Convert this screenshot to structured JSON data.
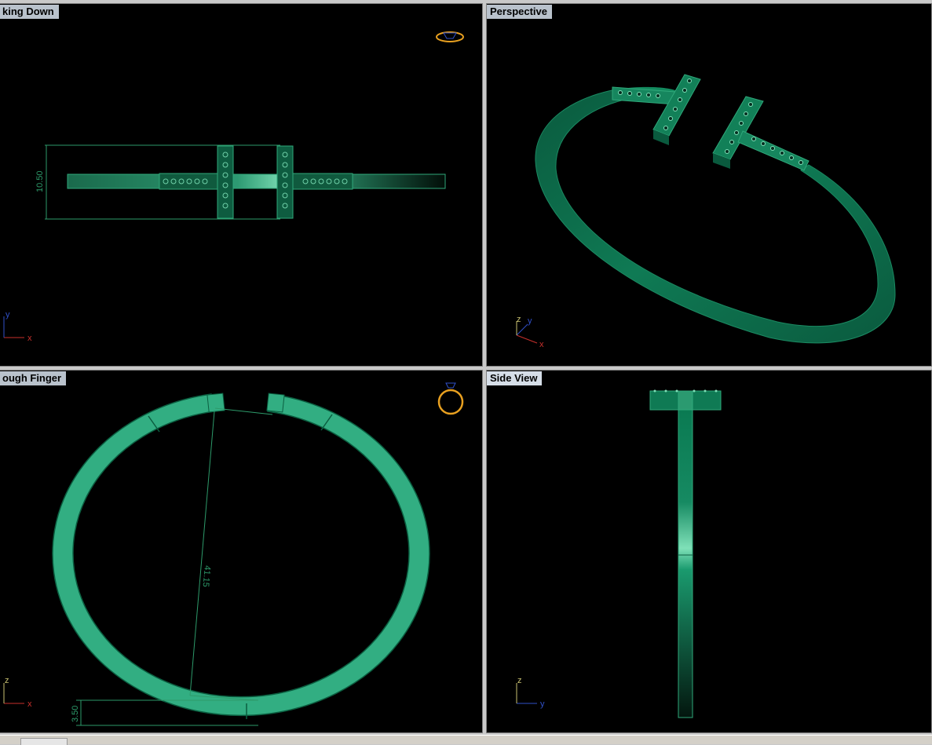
{
  "viewports": {
    "top": {
      "title": "king Down",
      "x_axis": "x",
      "y_axis": "y",
      "dimension": "10.50"
    },
    "perspective": {
      "title": "Perspective",
      "x_axis": "x",
      "y_axis": "y",
      "z_axis": "z"
    },
    "front": {
      "title": "ough Finger",
      "x_axis": "x",
      "z_axis": "z",
      "dimension_diameter": "41.15",
      "dimension_thickness": "3.50"
    },
    "side": {
      "title": "Side View",
      "y_axis": "y",
      "z_axis": "z"
    }
  },
  "colors": {
    "viewport_bg": "#000000",
    "model_green": "#2fa87a",
    "model_dark": "#0a6a48",
    "dim_line": "#2d9a6a",
    "axis_x": "#c8302c",
    "axis_y": "#3050c8",
    "axis_z": "#c8c070",
    "title_bg": "#b9c2cc",
    "icon_orange": "#e8a020"
  }
}
